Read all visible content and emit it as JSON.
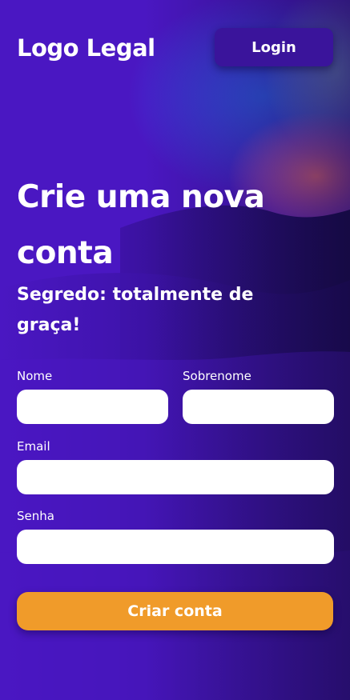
{
  "header": {
    "logo_text": "Logo Legal",
    "login_label": "Login"
  },
  "hero": {
    "title": "Crie uma nova conta",
    "subtitle": "Segredo: totalmente de graça!"
  },
  "form": {
    "first_name_label": "Nome",
    "last_name_label": "Sobrenome",
    "email_label": "Email",
    "password_label": "Senha",
    "first_name_value": "",
    "last_name_value": "",
    "email_value": "",
    "password_value": "",
    "submit_label": "Criar conta"
  },
  "colors": {
    "background": "#4a17c2",
    "login_button": "#3a149b",
    "submit_button": "#f09b2a",
    "text": "#ffffff",
    "field": "#ffffff"
  }
}
